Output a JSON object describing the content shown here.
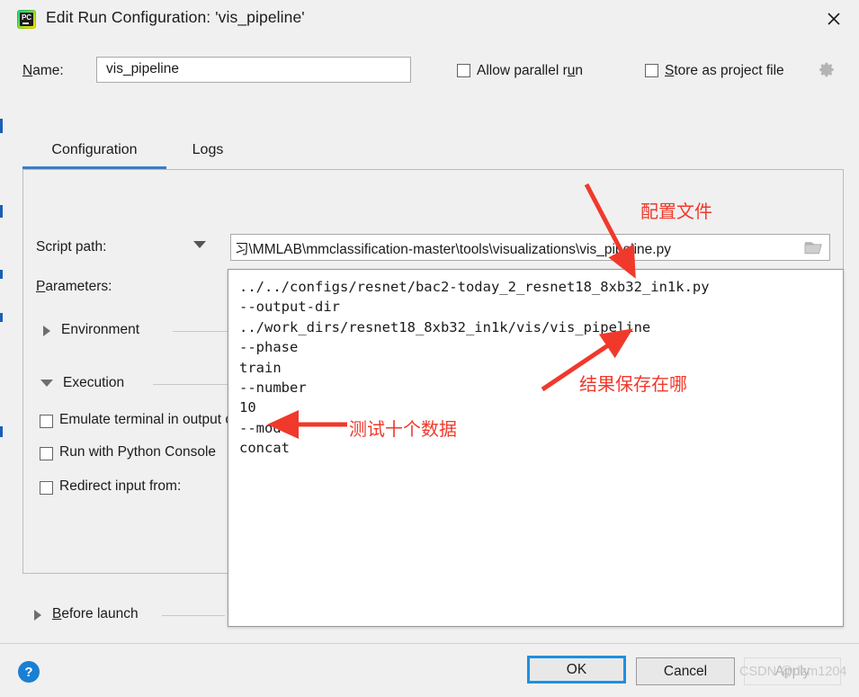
{
  "window": {
    "title": "Edit Run Configuration: 'vis_pipeline'",
    "app_icon": "pycharm-icon",
    "app_icon_text": "PC",
    "close_icon": "close-icon"
  },
  "name_row": {
    "label": "Name:",
    "value": "vis_pipeline",
    "placeholder": "",
    "allow_parallel_run": {
      "label": "Allow parallel run",
      "checked": false
    },
    "store_as_project_file": {
      "label": "Store as project file",
      "checked": false
    },
    "gear_icon": "gear-icon"
  },
  "tabs": [
    {
      "label": "Configuration",
      "active": true
    },
    {
      "label": "Logs",
      "active": false
    }
  ],
  "form": {
    "script_path": {
      "label": "Script path:",
      "value": "习\\MMLAB\\mmclassification-master\\tools\\visualizations\\vis_pipeline.py",
      "browse_icon": "folder-icon",
      "dropdown_icon": "chevron-down-icon"
    },
    "parameters": {
      "label": "Parameters:",
      "value": "../../configs/resnet/bac2-today_2_resnet18_8xb32_in1k.py\n--output-dir\n../work_dirs/resnet18_8xb32_in1k/vis/vis_pipeline\n--phase\ntrain\n--number\n10\n--mode\nconcat"
    },
    "sections": [
      {
        "label": "Environment",
        "expanded": false,
        "icon": "chevron-right-icon"
      },
      {
        "label": "Execution",
        "expanded": true,
        "icon": "chevron-down-icon"
      }
    ],
    "execution_options": [
      {
        "label": "Emulate terminal in output console",
        "checked": false
      },
      {
        "label": "Run with Python Console",
        "checked": false
      },
      {
        "label": "Redirect input from:",
        "checked": false
      }
    ],
    "before_launch": {
      "label": "Before launch",
      "expanded": false,
      "icon": "chevron-right-icon"
    }
  },
  "footer": {
    "help_label": "?",
    "ok_label": "OK",
    "cancel_label": "Cancel",
    "apply_label": "Apply",
    "watermark": "CSDN @dzm1204"
  },
  "annotations": [
    {
      "id": "config-file",
      "text": "配置文件"
    },
    {
      "id": "where-results-saved",
      "text": "结果保存在哪"
    },
    {
      "id": "test-ten-items",
      "text": "测试十个数据"
    }
  ],
  "colors": {
    "accent": "#3d7ebf",
    "annotation": "#f0392b",
    "default_button_border": "#1e90e0",
    "help_blue": "#1a7fd4"
  }
}
